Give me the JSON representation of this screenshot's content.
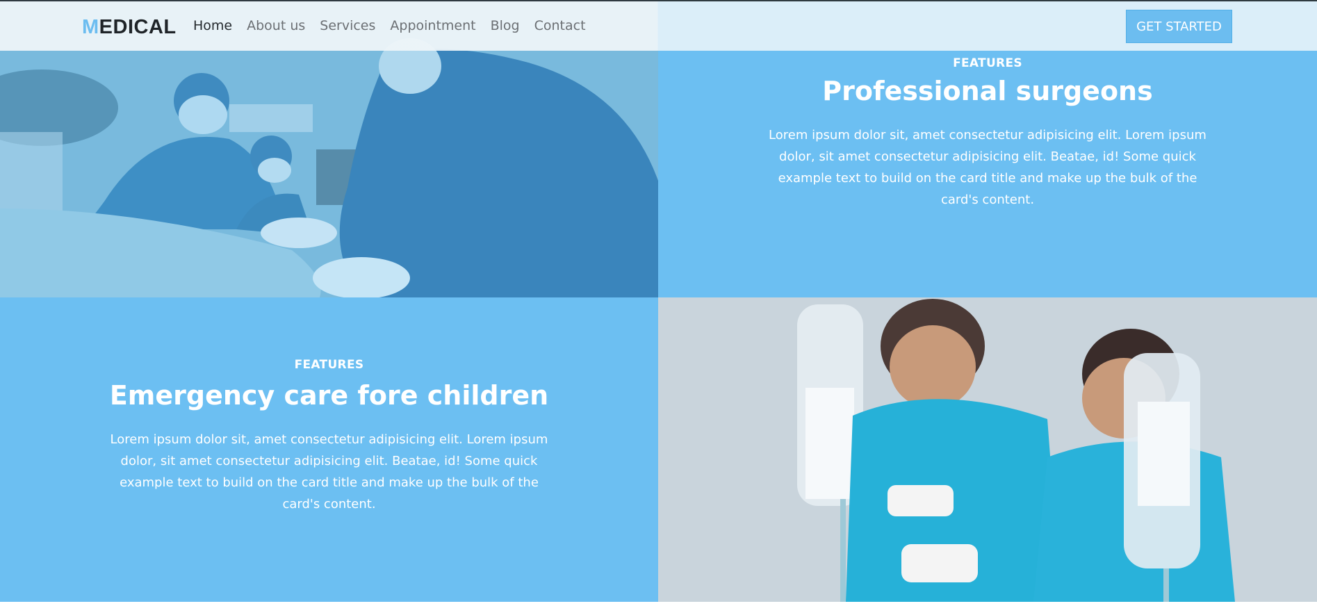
{
  "brand": {
    "first_letter": "M",
    "rest": "EDICAL"
  },
  "nav": {
    "items": [
      {
        "label": "Home",
        "active": true
      },
      {
        "label": "About us",
        "active": false
      },
      {
        "label": "Services",
        "active": false
      },
      {
        "label": "Appointment",
        "active": false
      },
      {
        "label": "Blog",
        "active": false
      },
      {
        "label": "Contact",
        "active": false
      }
    ],
    "cta_label": "GET STARTED"
  },
  "features": [
    {
      "eyebrow": "FEATURES",
      "title": "Professional surgeons",
      "text": "Lorem ipsum dolor sit, amet consectetur adipisicing elit. Lorem ipsum dolor, sit amet consectetur adipisicing elit. Beatae, id! Some quick example text to build on the card title and make up the bulk of the card's content."
    },
    {
      "eyebrow": "FEATURES",
      "title": "Emergency care fore children",
      "text": "Lorem ipsum dolor sit, amet consectetur adipisicing elit. Lorem ipsum dolor, sit amet consectetur adipisicing elit. Beatae, id! Some quick example text to build on the card title and make up the bulk of the card's content."
    }
  ],
  "colors": {
    "accent": "#6cbdf0",
    "panel": "#6cbff2",
    "text_dark": "#1f2428"
  }
}
